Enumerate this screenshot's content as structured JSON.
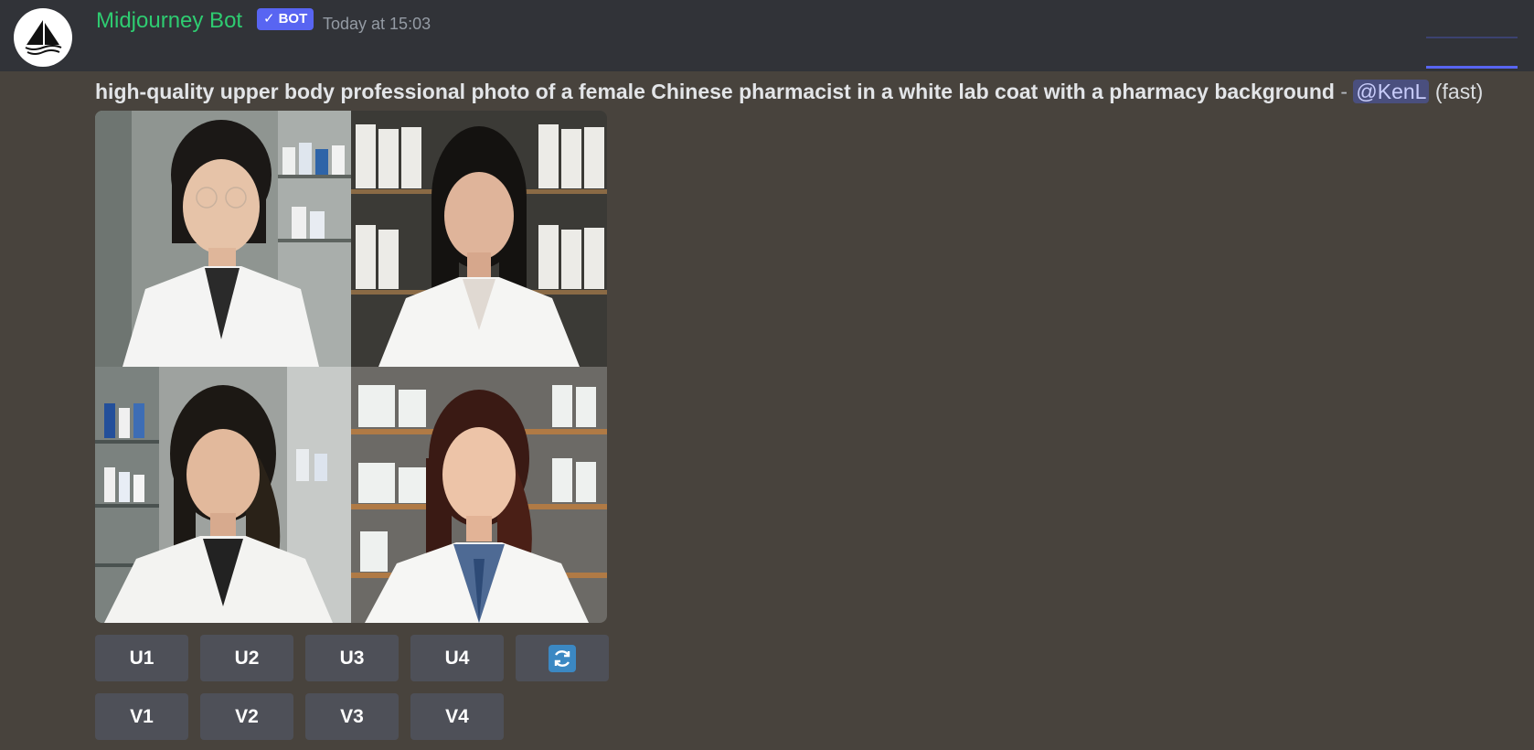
{
  "message": {
    "author": "Midjourney Bot",
    "bot_tag": "BOT",
    "timestamp": "Today at 15:03",
    "prompt_text": "high-quality upper body professional photo of a female Chinese pharmacist in a white lab coat with a pharmacy background",
    "separator": " - ",
    "mention": "@KenL",
    "mode": "(fast)"
  },
  "image_grid": {
    "tiles": [
      {
        "name": "tile-1"
      },
      {
        "name": "tile-2"
      },
      {
        "name": "tile-3"
      },
      {
        "name": "tile-4"
      }
    ]
  },
  "buttons": {
    "upscale": [
      "U1",
      "U2",
      "U3",
      "U4"
    ],
    "variation": [
      "V1",
      "V2",
      "V3",
      "V4"
    ],
    "reroll_icon": "refresh-icon"
  },
  "colors": {
    "username": "#2ecc71",
    "bot_tag": "#5865f2",
    "button": "#4e5058",
    "background": "#48433d"
  }
}
